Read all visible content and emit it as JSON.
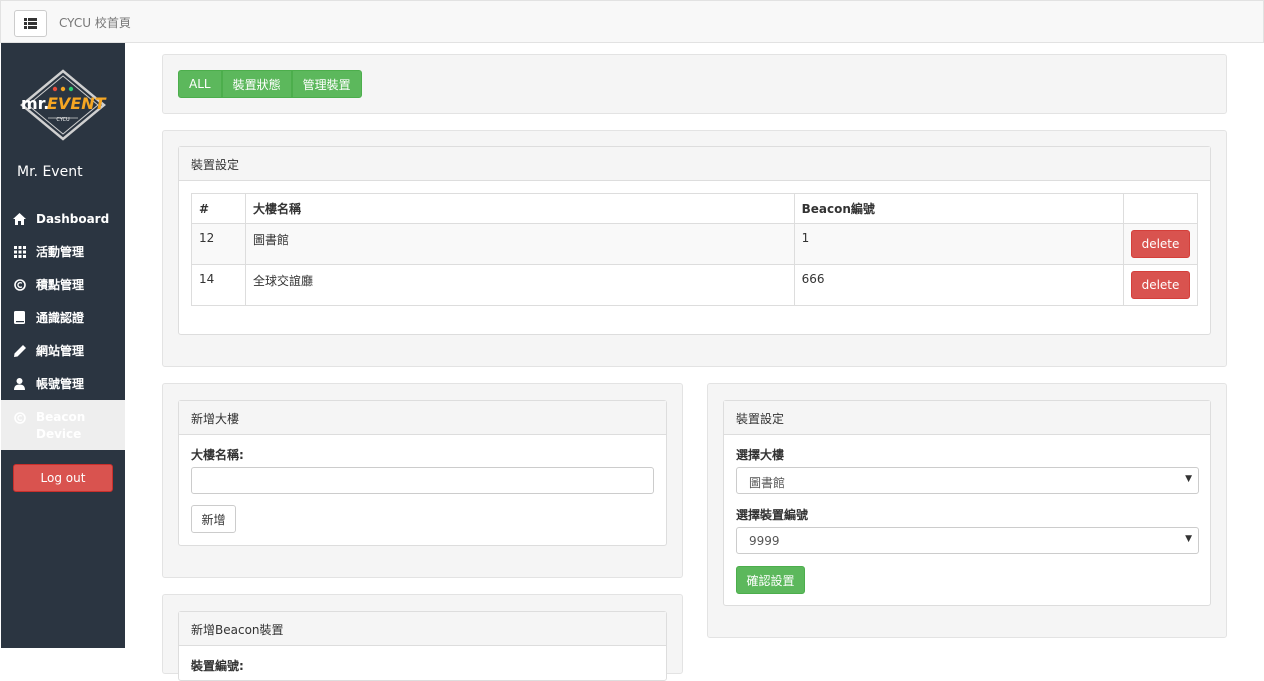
{
  "topbar": {
    "home_link": "CYCU 校首頁"
  },
  "sidebar": {
    "logo_text": "mr.EVENT",
    "logo_sub": "CYCU",
    "title": "Mr. Event",
    "items": [
      {
        "label": "Dashboard",
        "icon": "home-icon"
      },
      {
        "label": "活動管理",
        "icon": "grid-icon"
      },
      {
        "label": "積點管理",
        "icon": "copyright-icon"
      },
      {
        "label": "通識認證",
        "icon": "book-icon"
      },
      {
        "label": "網站管理",
        "icon": "pencil-icon"
      },
      {
        "label": "帳號管理",
        "icon": "user-icon"
      },
      {
        "label": "Beacon Device",
        "icon": "copyright-icon"
      }
    ],
    "logout": "Log out"
  },
  "filter_tabs": [
    "ALL",
    "裝置狀態",
    "管理裝置"
  ],
  "device_settings_table": {
    "heading": "裝置設定",
    "columns": [
      "#",
      "大樓名稱",
      "Beacon編號",
      ""
    ],
    "rows": [
      {
        "id": "12",
        "building": "圖書館",
        "beacon": "1",
        "action": "delete"
      },
      {
        "id": "14",
        "building": "全球交誼廳",
        "beacon": "666",
        "action": "delete"
      }
    ]
  },
  "add_building": {
    "heading": "新增大樓",
    "label": "大樓名稱:",
    "value": "",
    "submit": "新增"
  },
  "device_config": {
    "heading": "裝置設定",
    "building_label": "選擇大樓",
    "building_value": "圖書館",
    "device_label": "選擇裝置編號",
    "device_value": "9999",
    "confirm": "確認設置"
  },
  "add_beacon": {
    "heading": "新增Beacon裝置",
    "label": "裝置編號:"
  },
  "colors": {
    "sidebar_bg": "#2b3541",
    "green": "#5cb85c",
    "red": "#d9534f",
    "logo_accent": "#f5a623"
  }
}
